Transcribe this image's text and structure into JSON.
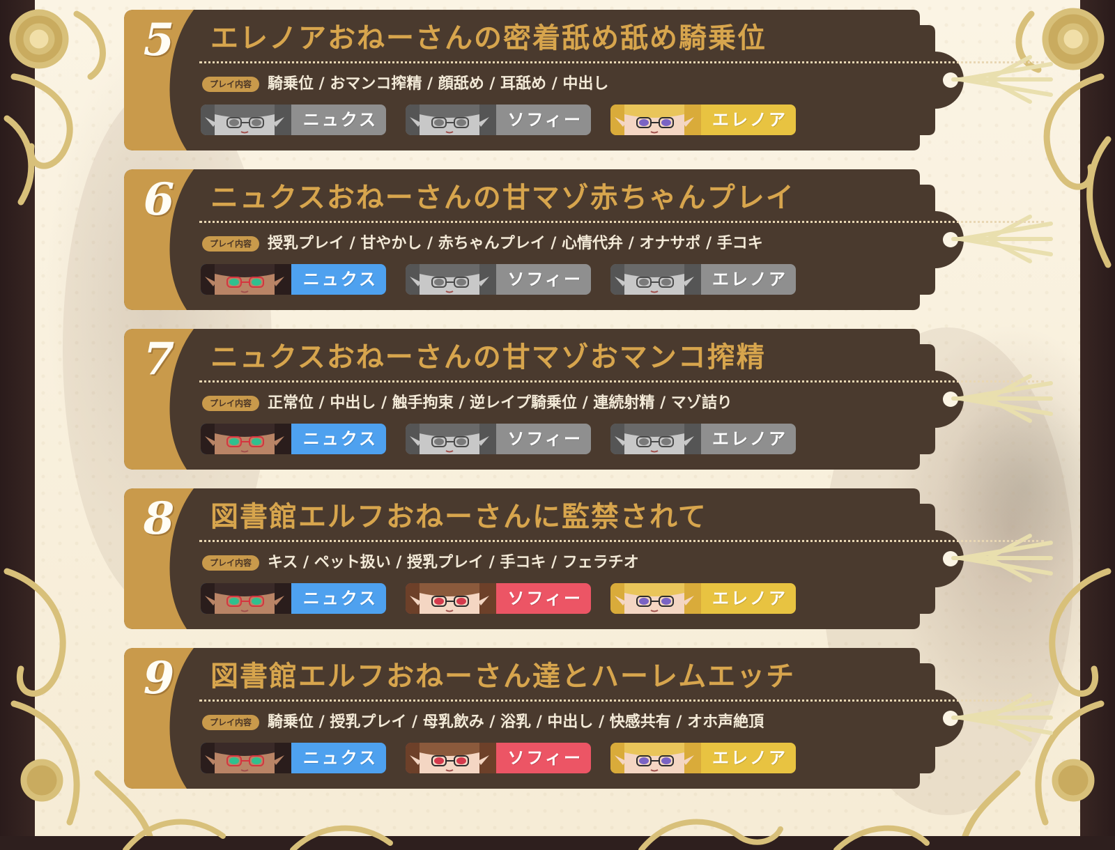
{
  "colors": {
    "card_body": "#4a3a2e",
    "card_accent": "#c99a4b",
    "title_gold": "#d7a54d",
    "inactive_chip": "#8f8f8f",
    "nyx_active": "#4ea1ef",
    "sophie_active": "#ec5565",
    "eleanor_active": "#e8c341",
    "frame_gold": "#d8c07a",
    "frame_dark": "#2e1f1e"
  },
  "play_label": "プレイ内容",
  "cards": [
    {
      "number": "5",
      "title": "エレノアおねーさんの密着舐め舐め騎乗位",
      "play_items": "騎乗位 / おマンコ搾精 / 顔舐め / 耳舐め / 中出し",
      "characters": [
        {
          "name": "ニュクス",
          "active": false,
          "portrait": "nyx-portrait-icon"
        },
        {
          "name": "ソフィー",
          "active": false,
          "portrait": "sophie-portrait-icon"
        },
        {
          "name": "エレノア",
          "active": true,
          "portrait": "eleanor-portrait-icon"
        }
      ]
    },
    {
      "number": "6",
      "title": "ニュクスおねーさんの甘マゾ赤ちゃんプレイ",
      "play_items": "授乳プレイ / 甘やかし / 赤ちゃんプレイ / 心情代弁 / オナサポ / 手コキ",
      "characters": [
        {
          "name": "ニュクス",
          "active": true,
          "portrait": "nyx-portrait-icon"
        },
        {
          "name": "ソフィー",
          "active": false,
          "portrait": "sophie-portrait-icon"
        },
        {
          "name": "エレノア",
          "active": false,
          "portrait": "eleanor-portrait-icon"
        }
      ]
    },
    {
      "number": "7",
      "title": "ニュクスおねーさんの甘マゾおマンコ搾精",
      "play_items": "正常位 / 中出し / 触手拘束 / 逆レイプ騎乗位 / 連続射精 / マゾ詰り",
      "characters": [
        {
          "name": "ニュクス",
          "active": true,
          "portrait": "nyx-portrait-icon"
        },
        {
          "name": "ソフィー",
          "active": false,
          "portrait": "sophie-portrait-icon"
        },
        {
          "name": "エレノア",
          "active": false,
          "portrait": "eleanor-portrait-icon"
        }
      ]
    },
    {
      "number": "8",
      "title": "図書館エルフおねーさんに監禁されて",
      "play_items": "キス / ペット扱い / 授乳プレイ / 手コキ / フェラチオ",
      "characters": [
        {
          "name": "ニュクス",
          "active": true,
          "portrait": "nyx-portrait-icon"
        },
        {
          "name": "ソフィー",
          "active": true,
          "portrait": "sophie-portrait-icon"
        },
        {
          "name": "エレノア",
          "active": true,
          "portrait": "eleanor-portrait-icon"
        }
      ]
    },
    {
      "number": "9",
      "title": "図書館エルフおねーさん達とハーレムエッチ",
      "play_items": "騎乗位 / 授乳プレイ / 母乳飲み / 浴乳 / 中出し / 快感共有 / オホ声絶頂",
      "characters": [
        {
          "name": "ニュクス",
          "active": true,
          "portrait": "nyx-portrait-icon"
        },
        {
          "name": "ソフィー",
          "active": true,
          "portrait": "sophie-portrait-icon"
        },
        {
          "name": "エレノア",
          "active": true,
          "portrait": "eleanor-portrait-icon"
        }
      ]
    }
  ]
}
